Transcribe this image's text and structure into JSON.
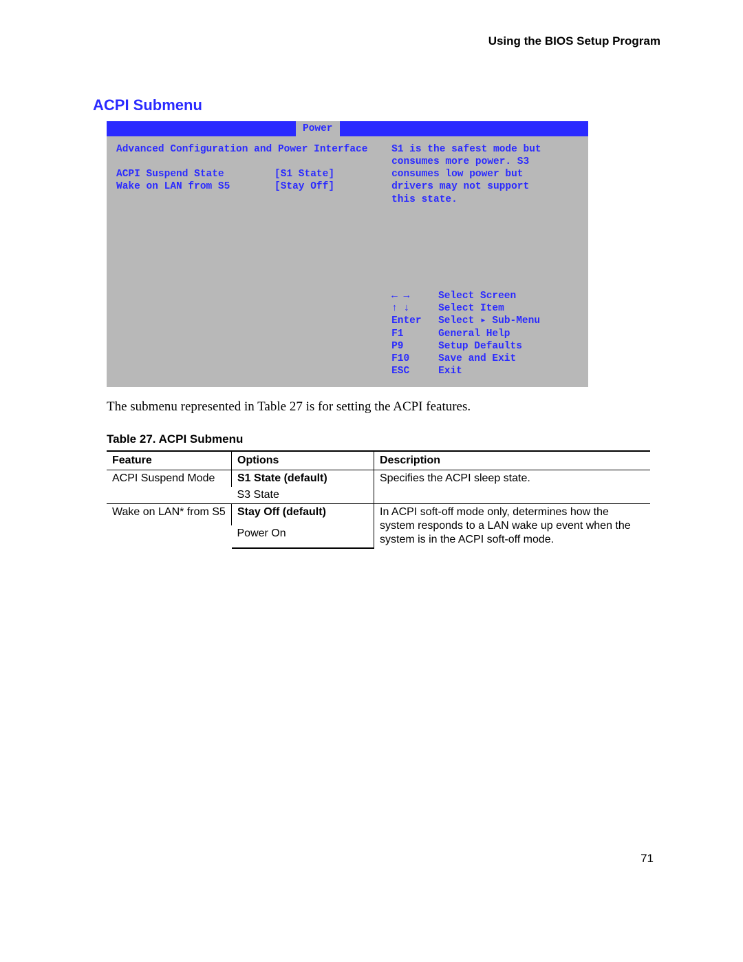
{
  "header": "Using the BIOS Setup Program",
  "section_title": "ACPI Submenu",
  "bios": {
    "tab": "Power",
    "heading": "Advanced Configuration and Power Interface",
    "rows": [
      {
        "label": "ACPI Suspend State",
        "value": "[S1 State]"
      },
      {
        "label": "Wake on LAN from S5",
        "value": "[Stay Off]"
      }
    ],
    "help1": "S1 is the safest mode but",
    "help2": "consumes more power.  S3",
    "help3": "consumes low power but",
    "help4": "drivers may not support",
    "help5": "this state.",
    "nav": [
      {
        "key": "← →",
        "label": "Select Screen"
      },
      {
        "key": "↑ ↓",
        "label": "Select Item"
      },
      {
        "key": "Enter",
        "label": "Select ▸ Sub-Menu"
      },
      {
        "key": "F1",
        "label": "General Help"
      },
      {
        "key": "P9",
        "label": "Setup Defaults"
      },
      {
        "key": "F10",
        "label": "Save and Exit"
      },
      {
        "key": "ESC",
        "label": "Exit"
      }
    ]
  },
  "body_text": "The submenu represented in Table 27 is for setting the ACPI features.",
  "table_caption": "Table 27.    ACPI Submenu",
  "table": {
    "headers": {
      "c1": "Feature",
      "c2": "Options",
      "c3": "Description"
    },
    "r1": {
      "feature": "ACPI Suspend Mode",
      "opt1": "S1 State (default)",
      "opt2": "S3 State",
      "desc": "Specifies the ACPI sleep state."
    },
    "r2": {
      "feature": "Wake on LAN* from S5",
      "opt1": "Stay Off (default)",
      "opt2": "Power On",
      "desc": "In ACPI soft-off mode only, determines how the system responds to a LAN wake up event when the system is in the ACPI soft-off mode."
    }
  },
  "page_number": "71"
}
